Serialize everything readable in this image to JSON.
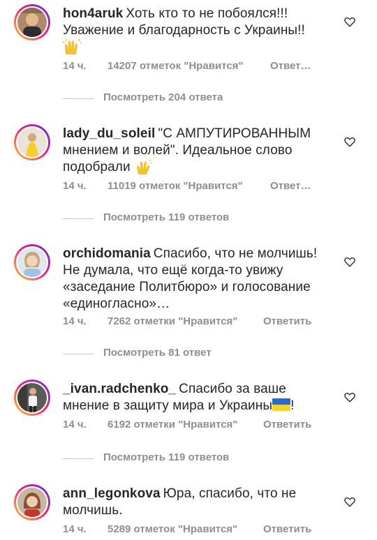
{
  "comments": [
    {
      "username": "hon4aruk",
      "text_lines": [
        "Хоть кто то не побоялся!!!",
        "Уважение и благодарность с Украины!!"
      ],
      "emoji": "clapping-hands",
      "time": "14 ч.",
      "likes": "14207 отметок \"Нравится\"",
      "reply": "Ответ…",
      "replies_label": "Посмотреть 204 ответа"
    },
    {
      "username": "lady_du_soleil",
      "text_lines": [
        "\"С АМПУТИРОВАННЫМ",
        "мнением и волей\". Идеальное слово",
        "подобрали"
      ],
      "emoji": "waving-hand",
      "time": "14 ч.",
      "likes": "11019 отметок \"Нравится\"",
      "reply": "Ответ…",
      "replies_label": "Посмотреть 119 ответов"
    },
    {
      "username": "orchidomania",
      "text_lines": [
        "Спасибо, что не молчишь!",
        "Не думала, что ещё когда-то увижу",
        "«заседание Политбюро» и голосование",
        "«единогласно»…"
      ],
      "time": "14 ч.",
      "likes": "7262 отметки \"Нравится\"",
      "reply": "Ответить",
      "replies_label": "Посмотреть 81 ответ"
    },
    {
      "username": "_ivan.radchenko_",
      "text_lines": [
        "Спасибо за ваше",
        "мнение в защиту мира и Украины",
        "!"
      ],
      "emoji": "ukraine-flag",
      "time": "14 ч.",
      "likes": "6192 отметки \"Нравится\"",
      "reply": "Ответить",
      "replies_label": "Посмотреть 119 ответов"
    },
    {
      "username": "ann_legonkova",
      "text_lines": [
        "Юра, спасибо, что не",
        "молчишь."
      ],
      "time": "14 ч.",
      "likes": "5289 отметок \"Нравится\"",
      "reply": "Ответить"
    }
  ],
  "icons": {
    "like": "heart-outline-icon"
  },
  "colors": {
    "text": "#262626",
    "meta": "#8e8e8e",
    "divider": "#c7c7c7"
  }
}
